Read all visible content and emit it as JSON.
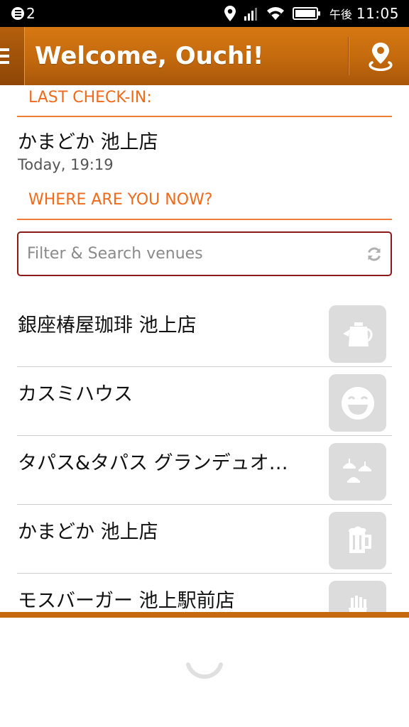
{
  "status_bar": {
    "notification_count": "2",
    "ampm": "午後",
    "time": "11:05"
  },
  "header": {
    "title": "Welcome, Ouchi!",
    "menu_icon": "hamburger-icon",
    "action_icon": "location-pin-icon"
  },
  "last_checkin": {
    "heading": "LAST CHECK-IN:",
    "venue": "かまどか 池上店",
    "time": "Today, 19:19"
  },
  "where_now": {
    "heading": "WHERE ARE YOU NOW?"
  },
  "search": {
    "placeholder": "Filter & Search venues",
    "value": ""
  },
  "venues": [
    {
      "name": "銀座椿屋珈琲 池上店",
      "icon": "coffee-pot-icon"
    },
    {
      "name": "カスミハウス",
      "icon": "smiley-icon"
    },
    {
      "name": "タパス&タパス グランデュオ…",
      "icon": "dining-icon"
    },
    {
      "name": "かまどか 池上店",
      "icon": "beer-mug-icon"
    },
    {
      "name": "モスバーガー 池上駅前店",
      "icon": "fries-icon"
    }
  ],
  "colors": {
    "accent": "#f06a1a",
    "header": "#c36a0e",
    "search_border": "#8b1a1a",
    "icon_tile": "#dcdcdc"
  }
}
